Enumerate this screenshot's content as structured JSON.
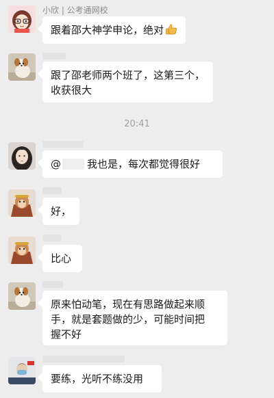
{
  "messages": [
    {
      "sender": "小欣 | 公考通网校",
      "text": "跟着邵大神学申论，绝对",
      "emoji": "thumbs-up"
    },
    {
      "sender": "",
      "text_lines": [
        "跟了邵老师两个班了，这第三个，",
        "收获很大"
      ]
    },
    {
      "time": "20:41"
    },
    {
      "sender": "",
      "mention_prefix": "@",
      "text": "我也是，每次都觉得很好"
    },
    {
      "sender": "",
      "text": "好，"
    },
    {
      "sender": "",
      "text": "比心"
    },
    {
      "sender": "",
      "text_lines": [
        "原来怕动笔，现在有思路做起来顺",
        "手，就是套题做的少，可能时间把",
        "握不好"
      ]
    },
    {
      "sender": "",
      "text": "要练，光听不练没用"
    }
  ],
  "colors": {
    "background": "#ededed",
    "bubble": "#ffffff",
    "meta_text": "#8c8c8c"
  }
}
